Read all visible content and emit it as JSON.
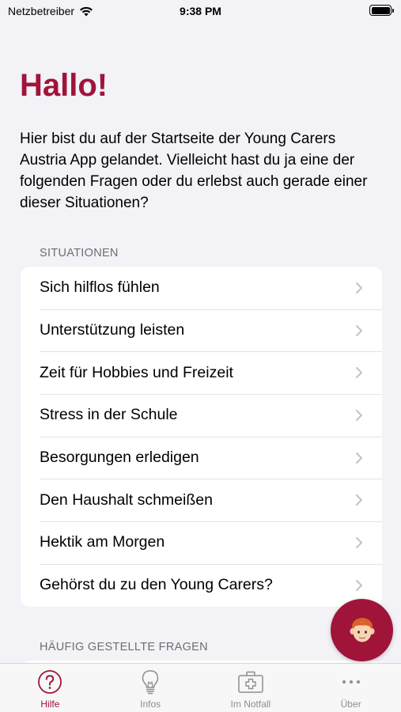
{
  "status_bar": {
    "carrier": "Netzbetreiber",
    "time": "9:38 PM"
  },
  "header": {
    "title": "Hallo!",
    "intro": "Hier bist du auf der Startseite der Young Carers Austria App gelandet. Vielleicht hast du ja eine der folgenden Fragen oder du erlebst auch gerade einer dieser Situationen?"
  },
  "situations": {
    "header": "SITUATIONEN",
    "items": [
      {
        "label": "Sich hilflos fühlen"
      },
      {
        "label": "Unterstützung leisten"
      },
      {
        "label": "Zeit für Hobbies und Freizeit"
      },
      {
        "label": "Stress in der Schule"
      },
      {
        "label": "Besorgungen erledigen"
      },
      {
        "label": "Den Haushalt schmeißen"
      },
      {
        "label": "Hektik am Morgen"
      },
      {
        "label": "Gehörst du zu den Young Carers?"
      }
    ]
  },
  "faq": {
    "header": "HÄUFIG GESTELLTE FRAGEN"
  },
  "tab_bar": {
    "tabs": [
      {
        "label": "Hilfe",
        "icon": "question-circle-icon",
        "active": true
      },
      {
        "label": "Infos",
        "icon": "lightbulb-icon",
        "active": false
      },
      {
        "label": "Im Notfall",
        "icon": "medical-kit-icon",
        "active": false
      },
      {
        "label": "Über",
        "icon": "ellipsis-icon",
        "active": false
      }
    ]
  },
  "colors": {
    "accent": "#a0143a",
    "background": "#f2f2f7",
    "secondary_text": "#6d6d72"
  }
}
